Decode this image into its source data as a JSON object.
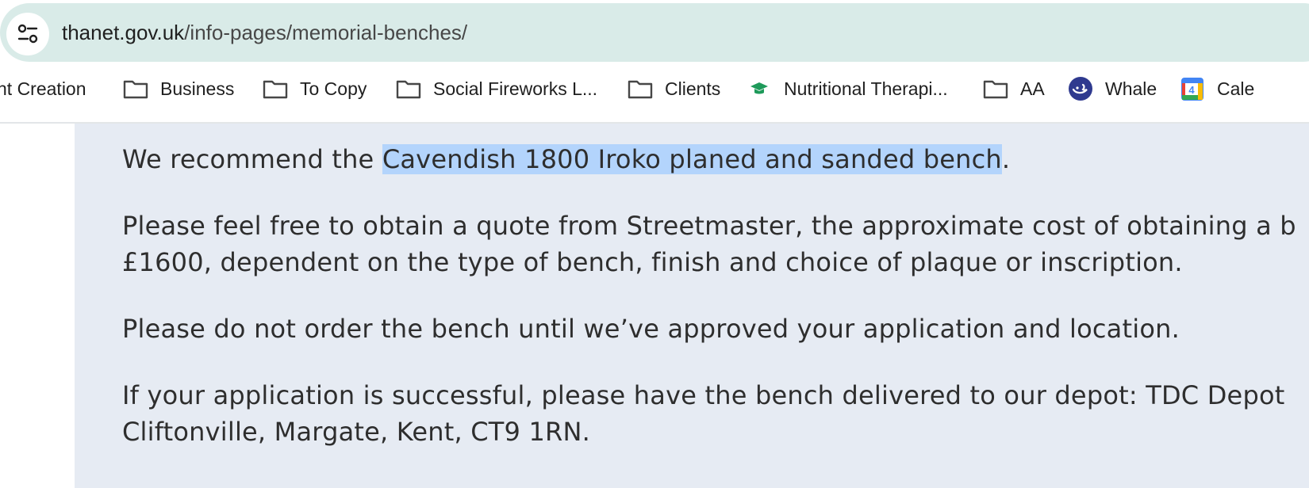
{
  "browser": {
    "url_host": "thanet.gov.uk",
    "url_path": "/info-pages/memorial-benches/"
  },
  "bookmarks": [
    {
      "label": "nt Creation",
      "icon": "none"
    },
    {
      "label": "Business",
      "icon": "folder-icon"
    },
    {
      "label": "To Copy",
      "icon": "folder-icon"
    },
    {
      "label": "Social Fireworks L...",
      "icon": "folder-icon"
    },
    {
      "label": "Clients",
      "icon": "folder-icon"
    },
    {
      "label": "Nutritional Therapi...",
      "icon": "graduation-cap-icon"
    },
    {
      "label": "AA",
      "icon": "folder-icon"
    },
    {
      "label": "Whale",
      "icon": "whale-icon"
    },
    {
      "label": "Cale",
      "icon": "calendar-icon"
    }
  ],
  "calendar_icon_number": "4",
  "content": {
    "p1_before": "We recommend the ",
    "p1_highlight": "Cavendish 1800 Iroko planed and sanded bench",
    "p1_after": ".",
    "p2_line1": "Please feel free to obtain a quote from Streetmaster, the approximate cost of obtaining a b",
    "p2_line2": "£1600, dependent on the type of bench, finish and choice of plaque or inscription.",
    "p3": "Please do not order the bench until we’ve approved your application and location.",
    "p4_line1": "If your application is successful, please have the bench delivered to our depot: TDC Depot",
    "p4_line2": "Cliftonville, Margate, Kent, CT9 1RN."
  },
  "colors": {
    "address_bar": "#d9ebe8",
    "content_background": "#e6ebf3",
    "selection_highlight": "#b3d4fc"
  }
}
